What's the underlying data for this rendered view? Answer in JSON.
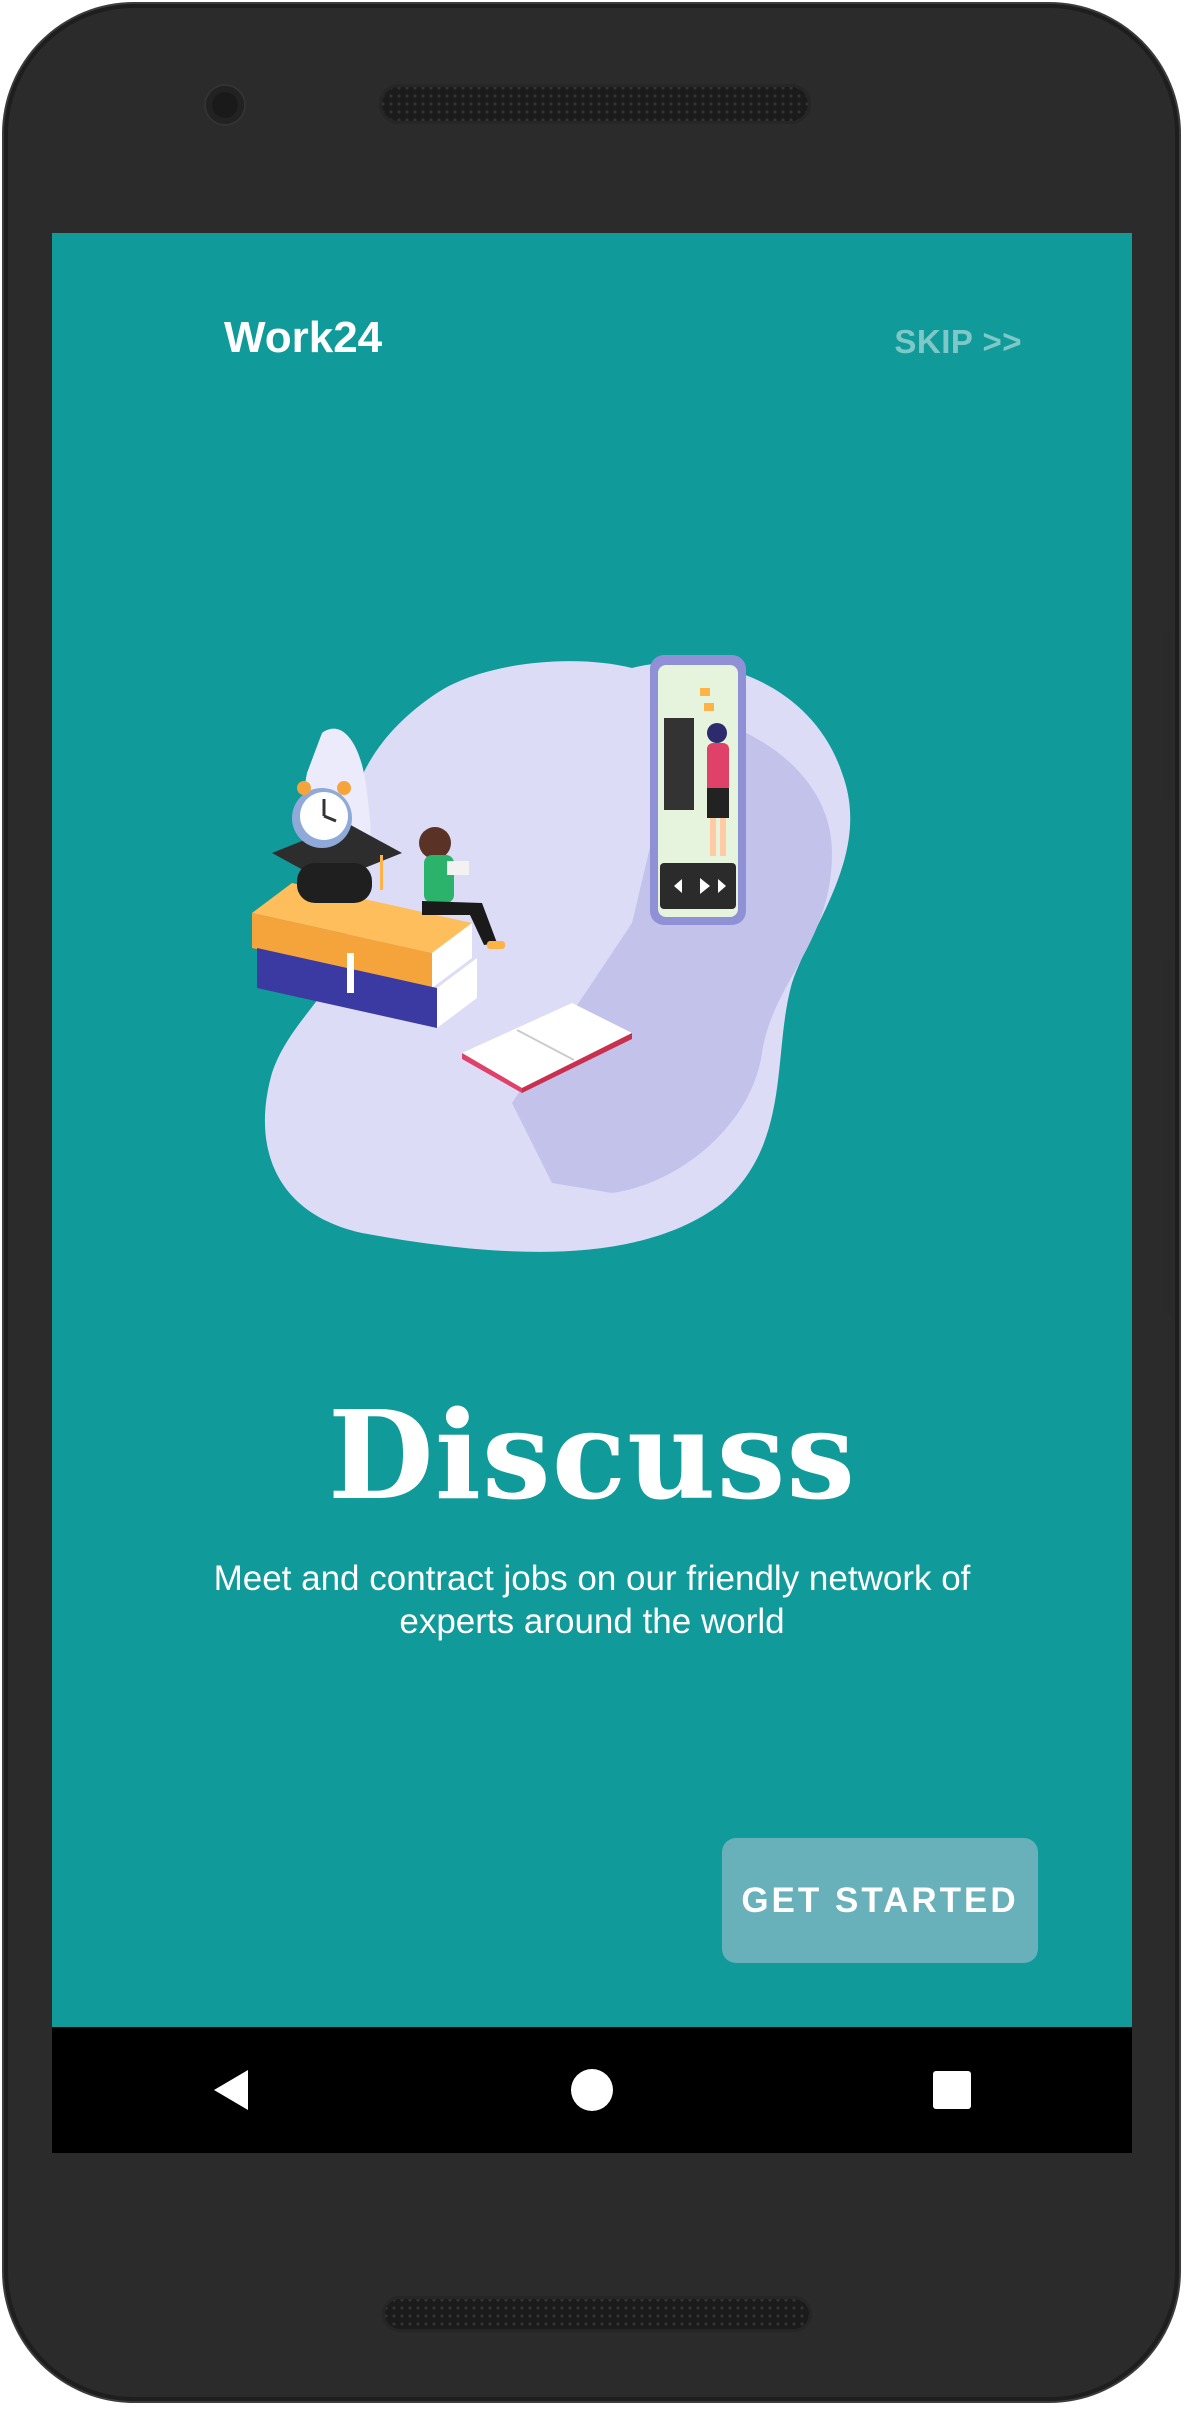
{
  "app": {
    "name": "Work24"
  },
  "header": {
    "skip_label": "SKIP >>"
  },
  "onboarding": {
    "title": "Discuss",
    "description": "Meet and contract jobs on our friendly network of experts around the world",
    "cta_label": "GET STARTED"
  },
  "navigation": {
    "back_icon": "back-triangle-icon",
    "home_icon": "home-circle-icon",
    "recents_icon": "recents-square-icon"
  },
  "colors": {
    "screen_background": "#109a99",
    "cta_background": "#68b0ba",
    "skip_text": "#7fc8c8"
  }
}
